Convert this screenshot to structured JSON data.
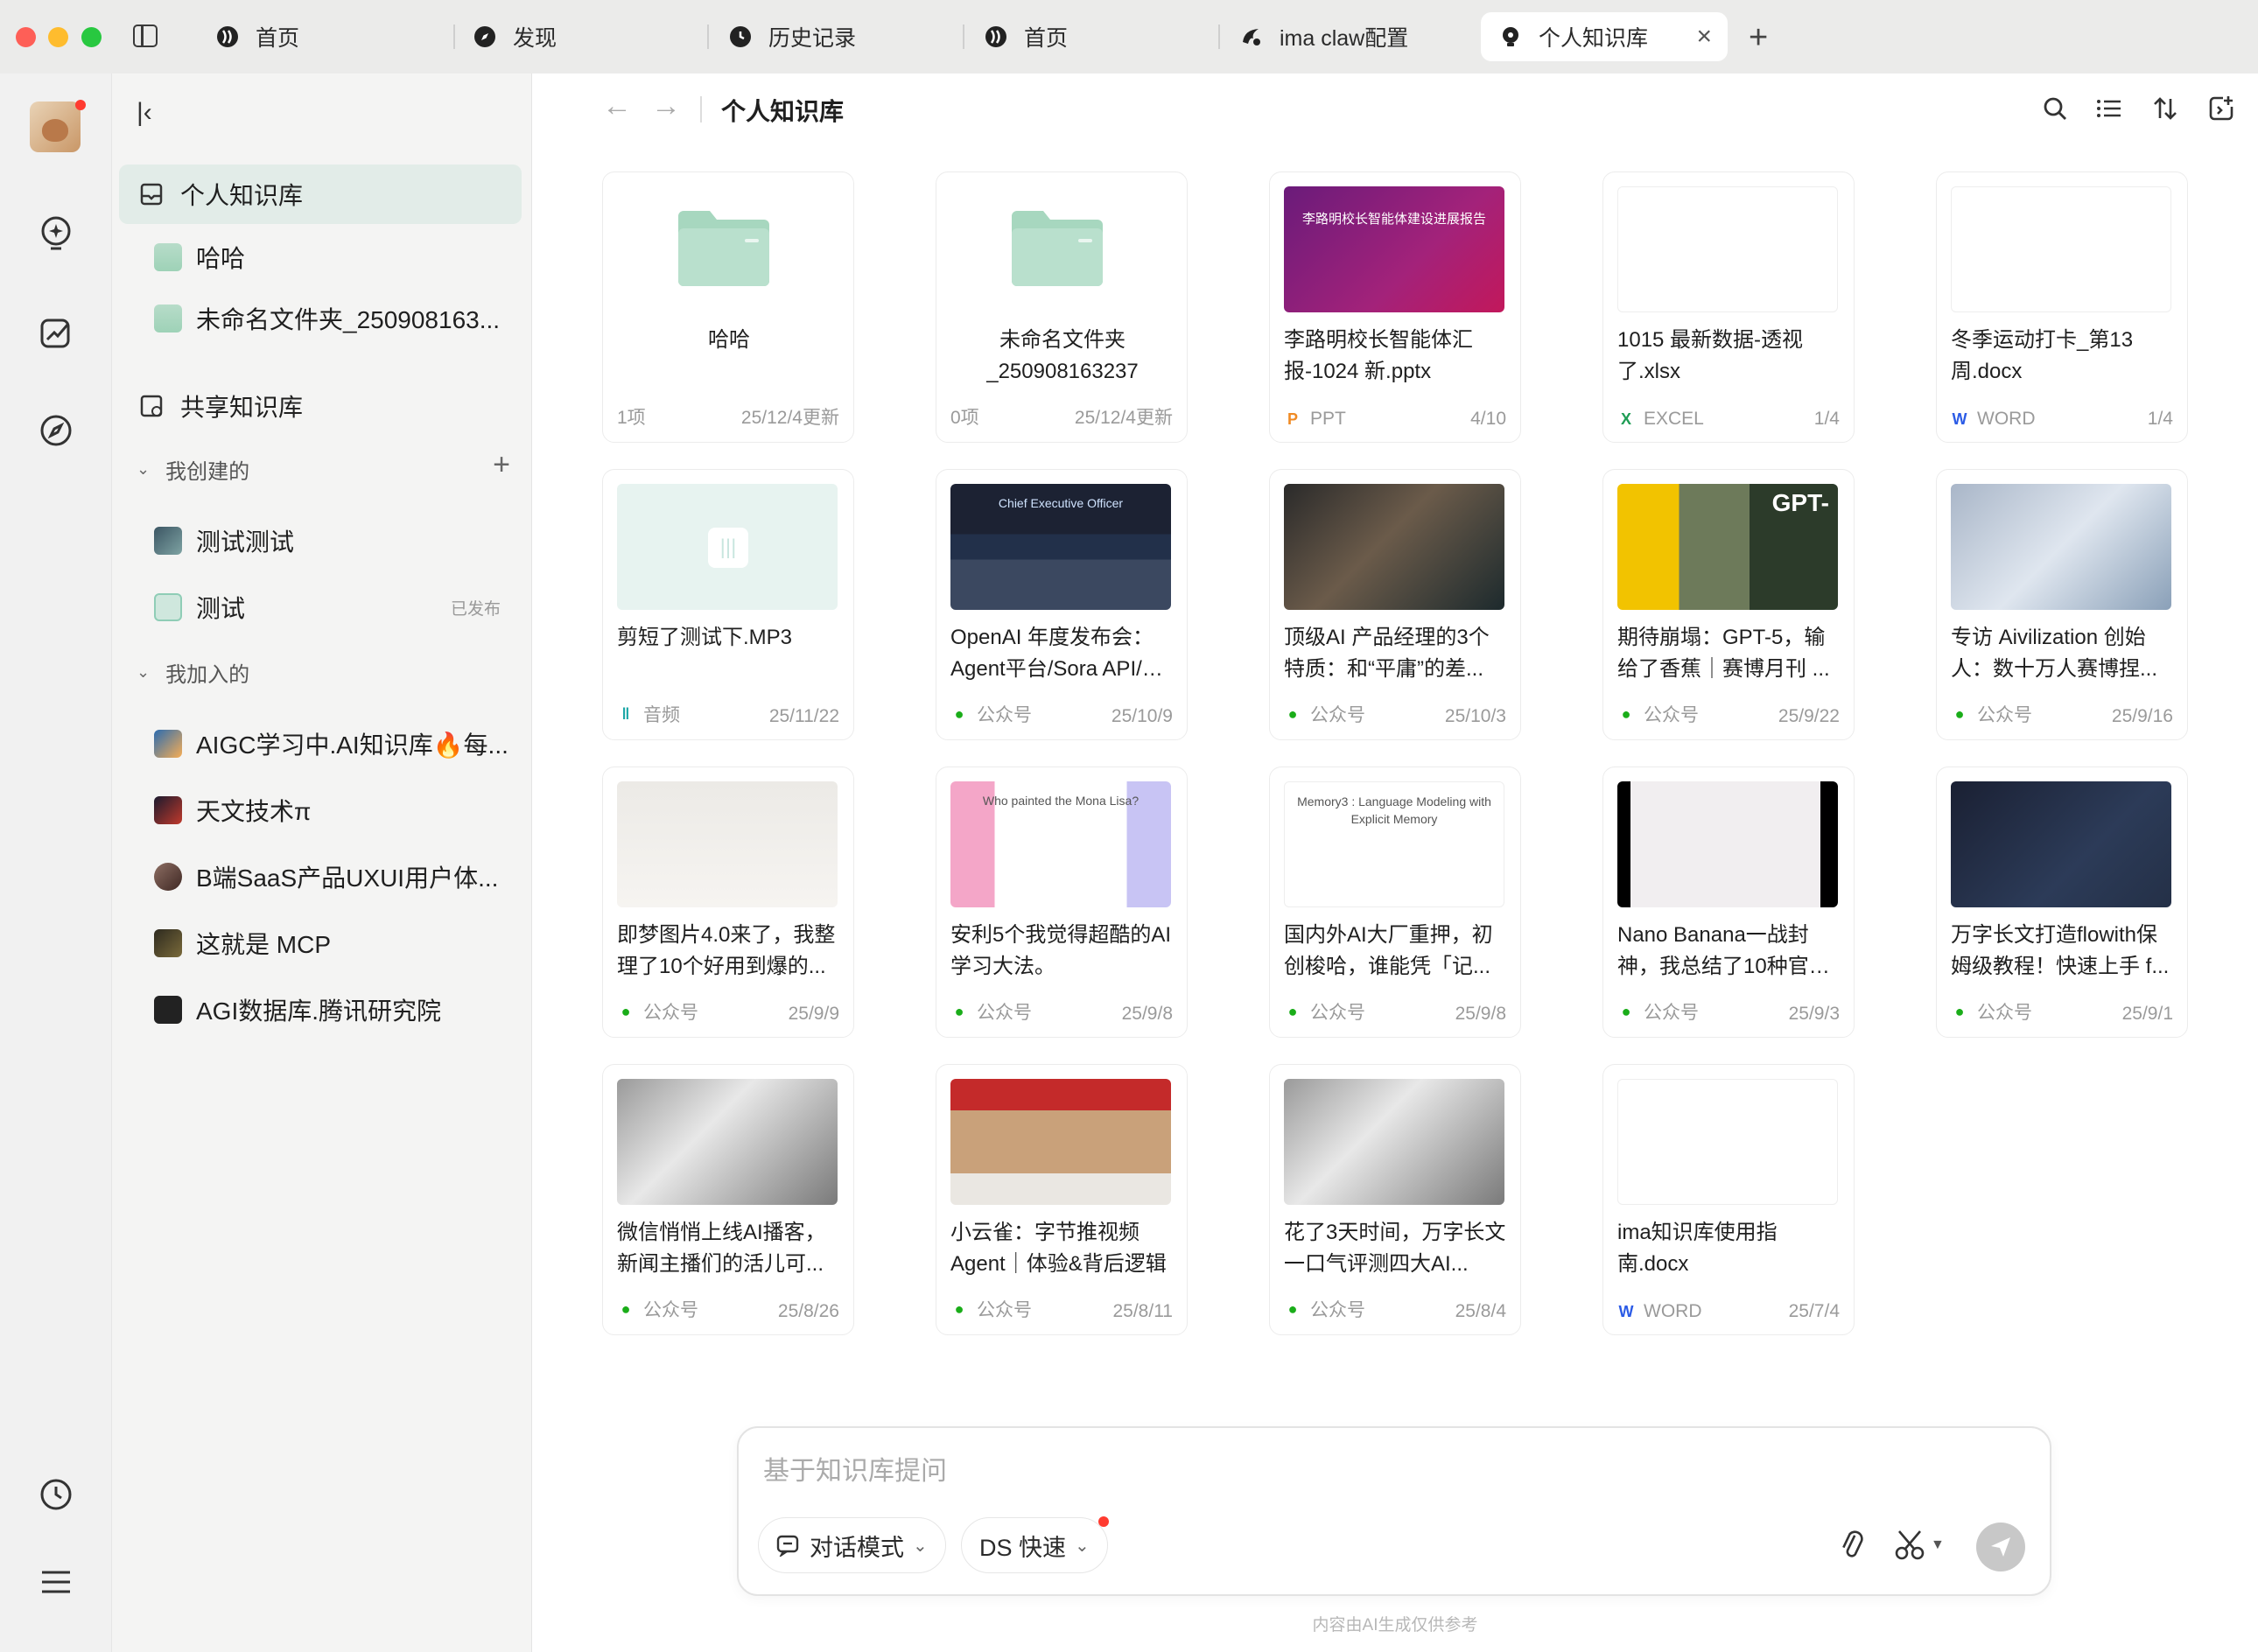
{
  "tabs": [
    {
      "label": "首页"
    },
    {
      "label": "发现"
    },
    {
      "label": "历史记录"
    },
    {
      "label": "首页"
    },
    {
      "label": "ima claw配置"
    },
    {
      "label": "个人知识库"
    }
  ],
  "nav": {
    "personal_kb": "个人知识库",
    "folders": [
      "哈哈",
      "未命名文件夹_250908163..."
    ],
    "shared_kb": "共享知识库",
    "created_header": "我创建的",
    "created": [
      {
        "label": "测试测试",
        "badge": ""
      },
      {
        "label": "测试",
        "badge": "已发布"
      }
    ],
    "joined_header": "我加入的",
    "joined": [
      {
        "label": "AIGC学习中.AI知识库🔥每..."
      },
      {
        "label": "天文技术π"
      },
      {
        "label": "B端SaaS产品UXUI用户体..."
      },
      {
        "label": "这就是 MCP"
      },
      {
        "label": "AGI数据库.腾讯研究院"
      }
    ]
  },
  "main": {
    "title": "个人知识库",
    "cards": [
      {
        "title": "哈哈",
        "type": "",
        "meta": "1项",
        "date": "25/12/4更新"
      },
      {
        "title": "未命名文件夹_250908163237",
        "type": "",
        "meta": "0项",
        "date": "25/12/4更新"
      },
      {
        "title": "李路明校长智能体汇报-1024 新.pptx",
        "type": "PPT",
        "meta": "PPT",
        "date": "4/10",
        "thumb_text": "李路明校长智能体建设进展报告"
      },
      {
        "title": "1015 最新数据-透视了.xlsx",
        "type": "EXCEL",
        "meta": "EXCEL",
        "date": "1/4"
      },
      {
        "title": "冬季运动打卡_第13周.docx",
        "type": "WORD",
        "meta": "WORD",
        "date": "1/4"
      },
      {
        "title": "剪短了测试下.MP3",
        "type": "音频",
        "meta": "音频",
        "date": "25/11/22"
      },
      {
        "title": "OpenAI 年度发布会：Agent平台/Sora API/第...",
        "type": "公众号",
        "meta": "公众号",
        "date": "25/10/9",
        "thumb_text": "Chief Executive Officer"
      },
      {
        "title": "顶级AI 产品经理的3个特质：和“平庸”的差...",
        "type": "公众号",
        "meta": "公众号",
        "date": "25/10/3"
      },
      {
        "title": "期待崩塌：GPT-5，输给了香蕉｜赛博月刊 ...",
        "type": "公众号",
        "meta": "公众号",
        "date": "25/9/22",
        "thumb_text": "GPT-"
      },
      {
        "title": "专访 Aivilization 创始人：数十万人赛博捏...",
        "type": "公众号",
        "meta": "公众号",
        "date": "25/9/16"
      },
      {
        "title": "即梦图片4.0来了，我整理了10个好用到爆的...",
        "type": "公众号",
        "meta": "公众号",
        "date": "25/9/9"
      },
      {
        "title": "安利5个我觉得超酷的AI学习大法。",
        "type": "公众号",
        "meta": "公众号",
        "date": "25/9/8",
        "thumb_text": "Who painted the Mona Lisa?"
      },
      {
        "title": "国内外AI大厂重押，初创梭哈，谁能凭「记...",
        "type": "公众号",
        "meta": "公众号",
        "date": "25/9/8",
        "thumb_text": "Memory3 : Language Modeling with Explicit Memory"
      },
      {
        "title": "Nano Banana一战封神，我总结了10种官方...",
        "type": "公众号",
        "meta": "公众号",
        "date": "25/9/3"
      },
      {
        "title": "万字长文打造flowith保姆级教程！快速上手 f...",
        "type": "公众号",
        "meta": "公众号",
        "date": "25/9/1"
      },
      {
        "title": "微信悄悄上线AI播客，新闻主播们的活儿可...",
        "type": "公众号",
        "meta": "公众号",
        "date": "25/8/26"
      },
      {
        "title": "小云雀：字节推视频Agent｜体验&背后逻辑",
        "type": "公众号",
        "meta": "公众号",
        "date": "25/8/11"
      },
      {
        "title": "花了3天时间，万字长文一口气评测四大AI...",
        "type": "公众号",
        "meta": "公众号",
        "date": "25/8/4"
      },
      {
        "title": "ima知识库使用指南.docx",
        "type": "WORD",
        "meta": "WORD",
        "date": "25/7/4"
      }
    ]
  },
  "ask": {
    "placeholder": "基于知识库提问",
    "mode_label": "对话模式",
    "model_label": "DS 快速",
    "disclaimer": "内容由AI生成仅供参考"
  },
  "colors": {
    "accent_green": "#1aad19",
    "selected_bg": "#e2ece8",
    "folder_green": "#a7d7bf",
    "ppt_orange": "#f08a24",
    "excel_green": "#1f9d55",
    "word_blue": "#2b5be6"
  }
}
